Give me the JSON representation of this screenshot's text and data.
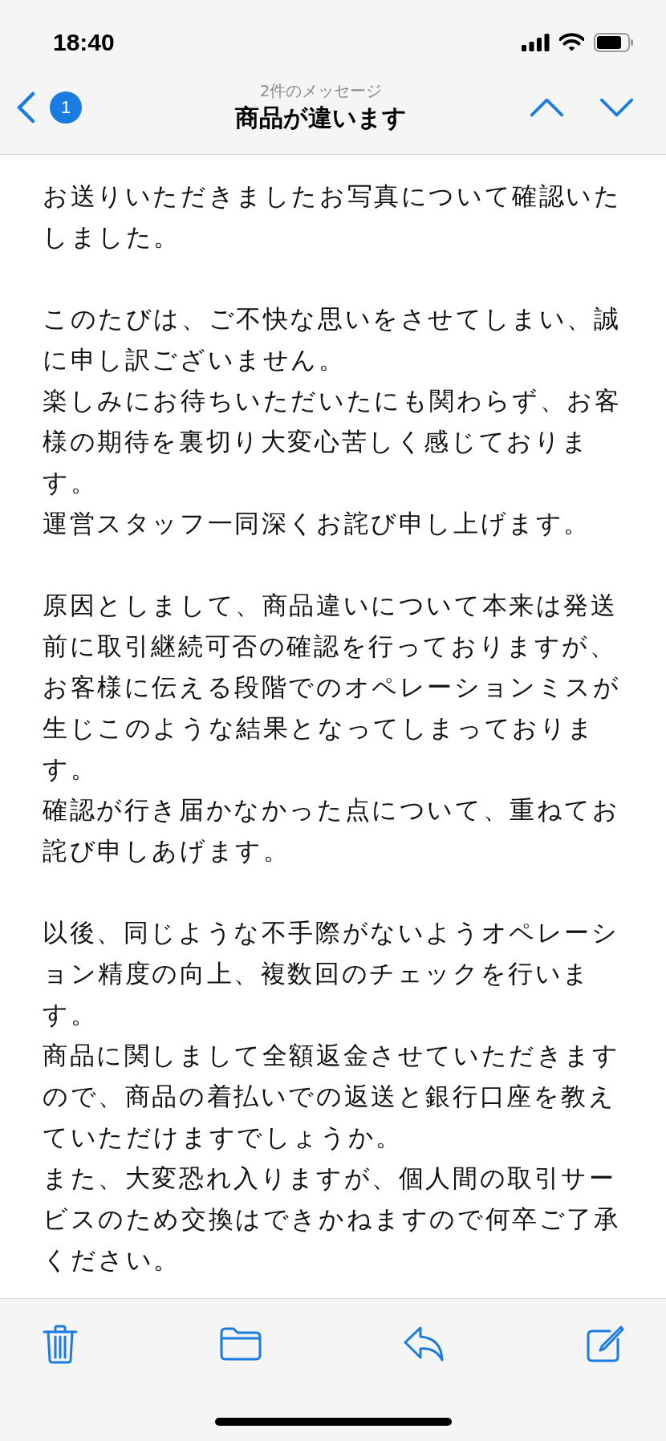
{
  "status_bar": {
    "time": "18:40"
  },
  "nav": {
    "unread_count": "1",
    "subtitle": "2件のメッセージ",
    "title": "商品が違います"
  },
  "body": [
    [
      "お送りいただきましたお写真について確認いた",
      "しました。"
    ],
    [
      "このたびは、ご不快な思いをさせてしまい、誠",
      "に申し訳ございません。",
      "楽しみにお待ちいただいたにも関わらず、お客",
      "様の期待を裏切り大変心苦しく感じておりま",
      "す。",
      "運営スタッフ一同深くお詫び申し上げます。"
    ],
    [
      "原因としまして、商品違いについて本来は発送",
      "前に取引継続可否の確認を行っておりますが、",
      "お客様に伝える段階でのオペレーションミスが",
      "生じこのような結果となってしまっておりま",
      "す。",
      "確認が行き届かなかった点について、重ねてお",
      "詫び申しあげます。"
    ],
    [
      "以後、同じような不手際がないようオペレーシ",
      "ョン精度の向上、複数回のチェックを行いま",
      "す。",
      "商品に関しまして全額返金させていただきます",
      "ので、商品の着払いでの返送と銀行口座を教え",
      "ていただけますでしょうか。",
      "また、大変恐れ入りますが、個人間の取引サー",
      "ビスのため交換はできかねますので何卒ご了承",
      "ください。"
    ]
  ]
}
